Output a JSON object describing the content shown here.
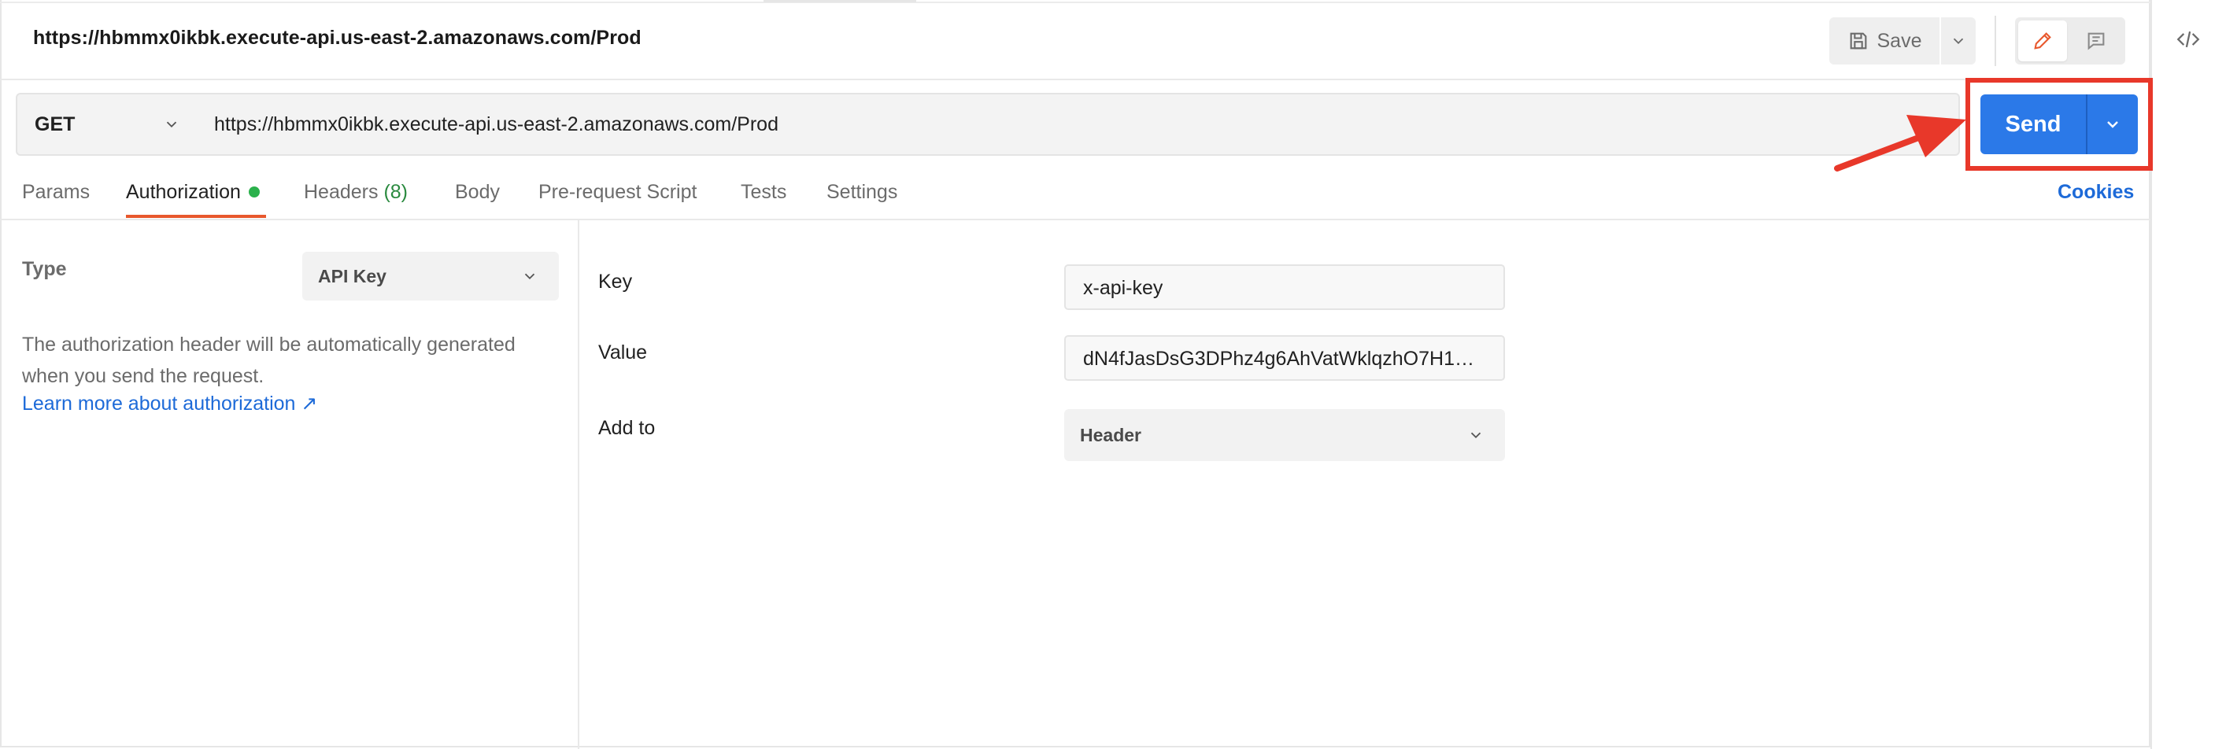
{
  "request": {
    "title": "https://hbmmx0ikbk.execute-api.us-east-2.amazonaws.com/Prod",
    "method": "GET",
    "url": "https://hbmmx0ikbk.execute-api.us-east-2.amazonaws.com/Prod"
  },
  "toolbar": {
    "save_label": "Save",
    "send_label": "Send"
  },
  "tabs": [
    {
      "label": "Params"
    },
    {
      "label": "Authorization"
    },
    {
      "label": "Headers",
      "count": "(8)"
    },
    {
      "label": "Body"
    },
    {
      "label": "Pre-request Script"
    },
    {
      "label": "Tests"
    },
    {
      "label": "Settings"
    }
  ],
  "active_tab": "Authorization",
  "cookies_label": "Cookies",
  "auth": {
    "type_label": "Type",
    "type_value": "API Key",
    "description": "The authorization header will be automatically generated when you send the request.",
    "learn_more": "Learn more about authorization ↗",
    "key_label": "Key",
    "key_value": "x-api-key",
    "value_label": "Value",
    "value_value": "dN4fJasDsG3DPhz4g6AhVatWklqzhO7H15...",
    "addto_label": "Add to",
    "addto_value": "Header"
  },
  "colors": {
    "send_button": "#2b79e8",
    "highlight": "#e8382a",
    "active_tab_underline": "#e8582d",
    "link": "#1d6ad8",
    "status_dot": "#2bb14c"
  },
  "icons": {
    "save": "save-icon",
    "edit": "pencil-icon",
    "comment": "comment-icon",
    "code": "code-icon",
    "dropdown": "chevron-down-icon"
  }
}
